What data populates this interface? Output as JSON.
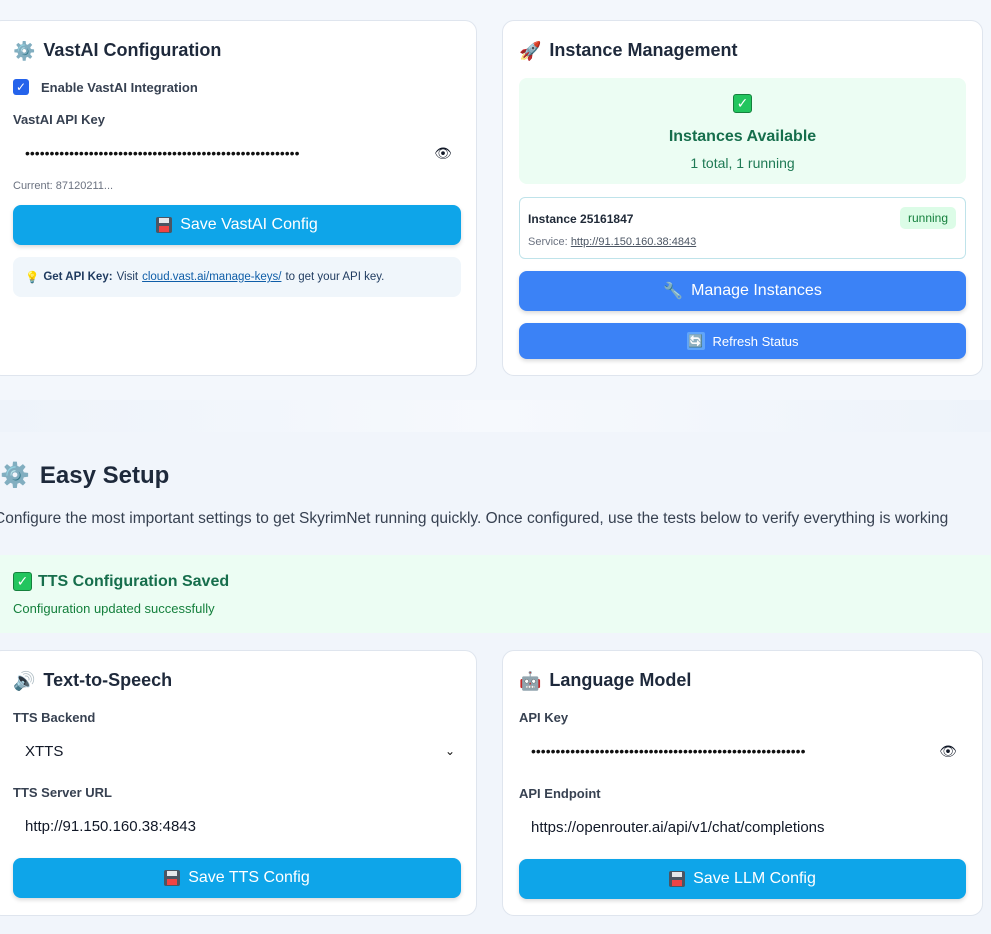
{
  "vastai": {
    "icon": "gear-icon",
    "title": "VastAI Configuration",
    "enable_label": "Enable VastAI Integration",
    "enable_checked": true,
    "api_key_label": "VastAI API Key",
    "api_key_masked": "••••••••••••••••••••••••••••••••••••••••••••••••••••••••",
    "current_text": "Current: 87120211...",
    "save_label": "Save VastAI Config",
    "tip_prefix": "Get API Key:",
    "tip_text_1": "Visit",
    "tip_link": "cloud.vast.ai/manage-keys/",
    "tip_text_2": "to get your API key."
  },
  "instances": {
    "icon": "rocket-icon",
    "title": "Instance Management",
    "status_title": "Instances Available",
    "status_sub": "1 total, 1 running",
    "instance_name": "Instance 25161847",
    "instance_status": "running",
    "service_label": "Service:",
    "service_url": "http://91.150.160.38:4843",
    "manage_label": "Manage Instances",
    "refresh_label": "Refresh Status"
  },
  "easy_setup": {
    "title": "Easy Setup",
    "description": "Configure the most important settings to get SkyrimNet running quickly. Once configured, use the tests below to verify everything is working"
  },
  "notice": {
    "title": "TTS Configuration Saved",
    "message": "Configuration updated successfully"
  },
  "tts": {
    "icon": "speaker-icon",
    "title": "Text-to-Speech",
    "backend_label": "TTS Backend",
    "backend_value": "XTTS",
    "url_label": "TTS Server URL",
    "url_value": "http://91.150.160.38:4843",
    "save_label": "Save TTS Config"
  },
  "llm": {
    "icon": "robot-icon",
    "title": "Language Model",
    "key_label": "API Key",
    "key_masked": "••••••••••••••••••••••••••••••••••••••••••••••••••••••••",
    "endpoint_label": "API Endpoint",
    "endpoint_value": "https://openrouter.ai/api/v1/chat/completions",
    "save_label": "Save LLM Config"
  },
  "colors": {
    "sky_button": "#0ea5e9",
    "blue_button": "#3b82f6",
    "success_bg": "#ecfdf3",
    "success_text": "#15803d"
  }
}
